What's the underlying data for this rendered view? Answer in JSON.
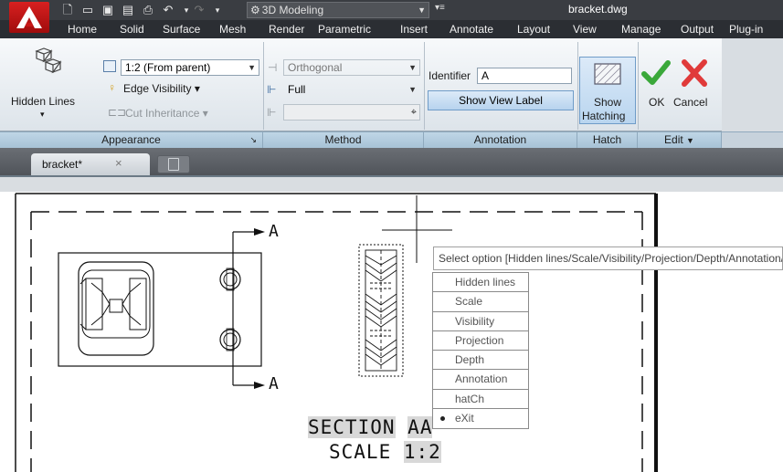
{
  "titlebar": {
    "workspace": "3D Modeling",
    "filename": "bracket.dwg"
  },
  "ribbon_tabs": [
    "Home",
    "Solid",
    "Surface",
    "Mesh",
    "Render",
    "Parametric",
    "Insert",
    "Annotate",
    "Layout",
    "View",
    "Manage",
    "Output",
    "Plug-in"
  ],
  "appearance_panel": {
    "title": "Appearance",
    "hidden_lines_label": "Hidden Lines",
    "scale_value": "1:2 (From parent)",
    "edge_visibility": "Edge Visibility",
    "cut_inheritance": "Cut Inheritance"
  },
  "method_panel": {
    "title": "Method",
    "projection_value": "Orthogonal",
    "depth_value": "Full"
  },
  "annotation_panel": {
    "title": "Annotation",
    "identifier_label": "Identifier",
    "identifier_value": "A",
    "show_view_label": "Show View Label"
  },
  "hatch_panel": {
    "title": "Hatch",
    "show_hatching_line1": "Show",
    "show_hatching_line2": "Hatching"
  },
  "edit_panel": {
    "title": "Edit",
    "ok_label": "OK",
    "cancel_label": "Cancel"
  },
  "document_tab": {
    "label": "bracket*"
  },
  "drawing": {
    "section_word": "SECTION",
    "section_letter": "A",
    "section_rest": "A",
    "scale_word": "SCALE",
    "scale_value": "1:2",
    "cut_label_top": "A",
    "cut_label_bottom": "A"
  },
  "command": {
    "prompt": "Select option [Hidden lines/Scale/Visibility/Projection/Depth/Annotation/hatCh/eXit] <eXit>:",
    "options": [
      "Hidden lines",
      "Scale",
      "Visibility",
      "Projection",
      "Depth",
      "Annotation",
      "hatCh",
      "eXit"
    ],
    "selected_option": "eXit"
  },
  "colors": {
    "titlebar": "#3a3d42",
    "ribbon_panel_title": "#a7c2d6",
    "ok_green": "#3aa83a",
    "cancel_red": "#e03a3a",
    "app_red": "#c81818"
  }
}
